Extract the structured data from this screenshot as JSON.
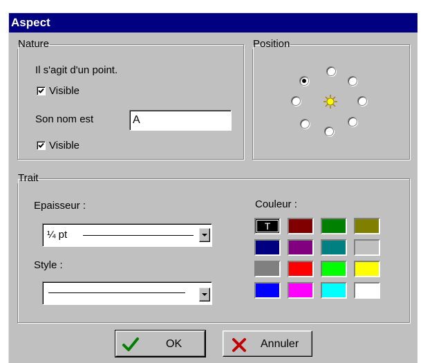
{
  "window": {
    "title": "Aspect"
  },
  "nature": {
    "legend": "Nature",
    "point_text": "Il s'agit d'un point.",
    "visible1_label": "Visible",
    "visible1_checked": true,
    "name_label": "Son nom est",
    "name_value": "A",
    "visible2_label": "Visible",
    "visible2_checked": true
  },
  "position": {
    "legend": "Position",
    "selected": "top-left"
  },
  "trait": {
    "legend": "Trait",
    "epaisseur_label": "Epaisseur :",
    "epaisseur_value": "¼ pt",
    "style_label": "Style :",
    "couleur_label": "Couleur :",
    "colors": [
      [
        "#000000",
        "#800000",
        "#008000",
        "#808000"
      ],
      [
        "#000080",
        "#800080",
        "#008080",
        "#c0c0c0"
      ],
      [
        "#808080",
        "#ff0000",
        "#00ff00",
        "#ffff00"
      ],
      [
        "#0000ff",
        "#ff00ff",
        "#00ffff",
        "#ffffff"
      ]
    ],
    "selected_swatch_text": "T"
  },
  "buttons": {
    "ok_label": "OK",
    "cancel_label": "Annuler"
  },
  "icons": {
    "check": "checkmark-icon",
    "cancel": "x-icon",
    "center": "sun-icon"
  }
}
